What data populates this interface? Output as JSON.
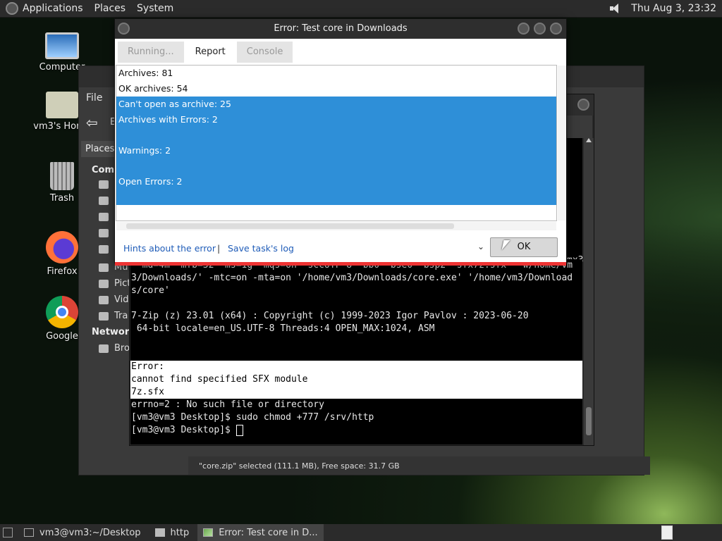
{
  "top_panel": {
    "menus": [
      "Applications",
      "Places",
      "System"
    ],
    "clock": "Thu Aug  3, 23:32"
  },
  "desktop_icons": [
    {
      "label": "Computer",
      "icon": "computer-icon"
    },
    {
      "label": "vm3's Home",
      "icon": "home-folder-icon"
    },
    {
      "label": "Trash",
      "icon": "trash-icon"
    },
    {
      "label": "Firefox",
      "icon": "firefox-icon"
    },
    {
      "label": "Google",
      "icon": "chrome-icon"
    }
  ],
  "file_manager": {
    "menu_file": "File",
    "toolbar_partial": "E",
    "places_tab": "Places",
    "section_computer": "Comp",
    "section_network": "Network",
    "side_items": [
      "",
      "",
      "",
      "",
      "",
      "Mu",
      "Pict",
      "Vid",
      "Tra"
    ],
    "network_item": "Bro",
    "status": "\"core.zip\" selected (111.1 MB), Free space: 31.7 GB"
  },
  "terminal": {
    "lines": [
      {
        "text": " -md=4m -mfb=32 -ms=1g -mqs=on -sccUTF-8 -bb0 -bse0 -bsp2 -sfx7z.sfx '-w/home/vm",
        "hl": false
      },
      {
        "text": "3/Downloads/' -mtc=on -mta=on '/home/vm3/Downloads/core.exe' '/home/vm3/Download",
        "hl": false
      },
      {
        "text": "s/core'",
        "hl": false
      },
      {
        "text": "",
        "hl": false
      },
      {
        "text": "7-Zip (z) 23.01 (x64) : Copyright (c) 1999-2023 Igor Pavlov : 2023-06-20",
        "hl": false
      },
      {
        "text": " 64-bit locale=en_US.UTF-8 Threads:4 OPEN_MAX:1024, ASM",
        "hl": false
      },
      {
        "text": "",
        "hl": false
      },
      {
        "text": "",
        "hl": false
      },
      {
        "text": "Error:",
        "hl": true
      },
      {
        "text": "cannot find specified SFX module",
        "hl": true
      },
      {
        "text": "7z.sfx",
        "hl": true
      },
      {
        "text": "errno=2 : No such file or directory",
        "hl": false
      },
      {
        "text": "[vm3@vm3 Desktop]$ sudo chmod +777 /srv/http",
        "hl": false
      },
      {
        "text": "[vm3@vm3 Desktop]$ ",
        "hl": false
      }
    ],
    "partial_top_right": "mx3"
  },
  "dialog": {
    "title": "Error: Test core in Downloads",
    "tabs": [
      "Running...",
      "Report",
      "Console"
    ],
    "active_tab": "Report",
    "report_lines": [
      {
        "text": "Archives: 81",
        "selected": false
      },
      {
        "text": "OK archives: 54",
        "selected": false
      },
      {
        "text": "Can't open as archive: 25",
        "selected": true
      },
      {
        "text": "Archives with Errors: 2",
        "selected": true
      },
      {
        "text": "",
        "selected": true
      },
      {
        "text": "Warnings: 2",
        "selected": true
      },
      {
        "text": "",
        "selected": true
      },
      {
        "text": "Open Errors: 2",
        "selected": true
      },
      {
        "text": "",
        "selected": true
      }
    ],
    "hints_link": "Hints about the error",
    "separator": "|",
    "save_log_link": "Save task's log",
    "ok_label": "OK"
  },
  "taskbar": {
    "tasks": [
      {
        "label": "vm3@vm3:~/Desktop",
        "icon": "terminal-icon"
      },
      {
        "label": "http",
        "icon": "folder-icon"
      },
      {
        "label": "Error: Test core in D...",
        "icon": "archive-icon"
      }
    ]
  },
  "colors": {
    "selection": "#2e8fd8",
    "error_bar": "#e33333",
    "link": "#1f5cb8"
  }
}
